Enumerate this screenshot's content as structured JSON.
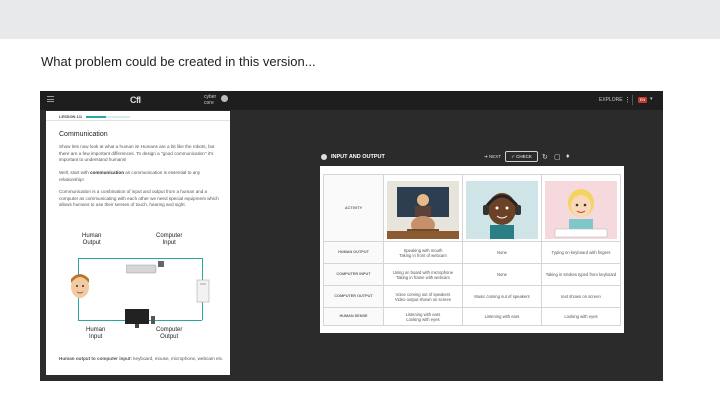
{
  "slide": {
    "title": "What problem could be created in this version..."
  },
  "app_header": {
    "logo": "CfI",
    "unit_line1": "cyber",
    "unit_line2": "core",
    "link": "EXPLORE",
    "badge": "EN"
  },
  "lesson": {
    "tab": "LESSON 1/1",
    "progress": 0.45,
    "heading": "Communication",
    "p1": "Show lets now look at what a human is! Humans are a bit like the robots, but there are a few important differences. To design a \"good communication\" it's important to understand humans!",
    "p2_pre": "Well, start with ",
    "p2_bold": "communication",
    "p2_post": " as communication is essential to any relationship!",
    "p3": "Communication is a combination of input and output from a human and a computer as communicating with each other we need special equipment which allows humans to use their senses of touch, hearing and sight.",
    "diagram": {
      "human_output": "Human\nOutput",
      "computer_input": "Computer\nInput",
      "human_input": "Human\nInput",
      "computer_output": "Computer\nOutput"
    },
    "foot_bold": "Human output to computer input:",
    "foot_rest": " keyboard, mouse, microphone, webcam etc."
  },
  "activity": {
    "title": "INPUT AND OUTPUT",
    "next_label": "NEXT",
    "check_label": "CHECK",
    "rows": [
      {
        "header": "ACTIVITY",
        "cells": [
          "",
          "",
          ""
        ]
      },
      {
        "header": "HUMAN OUTPUT",
        "cells": [
          "Speaking with mouth\nTaking in front of webcam",
          "None",
          "Typing on keyboard with fingers"
        ]
      },
      {
        "header": "COMPUTER INPUT",
        "cells": [
          "Using on board with microphone\nTaking in frame with webcam",
          "None",
          "Taking in strokes typed from keyboard"
        ]
      },
      {
        "header": "COMPUTER OUTPUT",
        "cells": [
          "Voice coming out of speakers\nVideo output shown on screen",
          "Music coming out of speakers",
          "text shown on screen"
        ]
      },
      {
        "header": "HUMAN SENSE",
        "cells": [
          "Listening with ears\nLooking with eyes",
          "Listening with ears",
          "Looking with eyes"
        ]
      }
    ]
  },
  "colors": {
    "accent": "#2aa8a0",
    "dark": "#2b2b2b",
    "badge": "#c0392b"
  }
}
